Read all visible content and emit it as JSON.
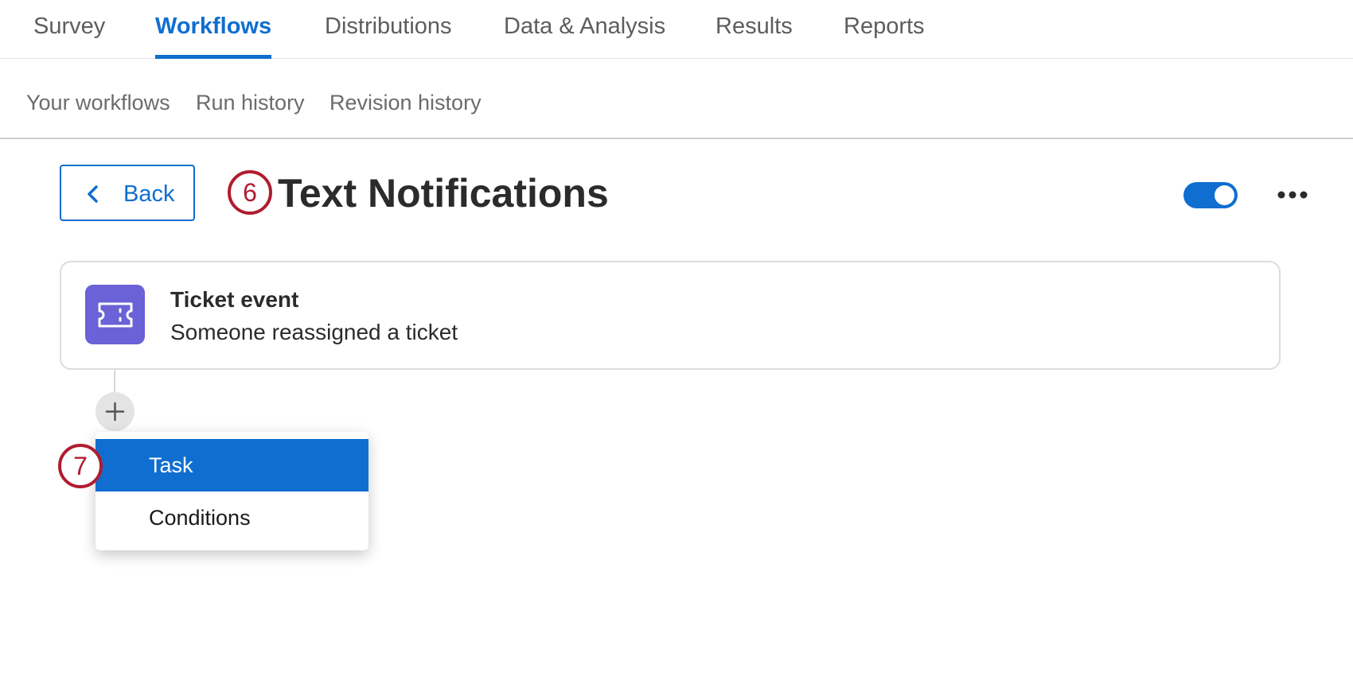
{
  "top_nav": {
    "tabs": [
      {
        "label": "Survey",
        "active": false
      },
      {
        "label": "Workflows",
        "active": true
      },
      {
        "label": "Distributions",
        "active": false
      },
      {
        "label": "Data & Analysis",
        "active": false
      },
      {
        "label": "Results",
        "active": false
      },
      {
        "label": "Reports",
        "active": false
      }
    ]
  },
  "sub_nav": {
    "items": [
      "Your workflows",
      "Run history",
      "Revision history"
    ]
  },
  "header": {
    "back_label": "Back",
    "step_badge": "6",
    "title": "Text Notifications",
    "toggle_on": true
  },
  "trigger_card": {
    "icon": "ticket-icon",
    "title": "Ticket event",
    "description": "Someone reassigned a ticket"
  },
  "add_menu": {
    "step_badge": "7",
    "items": [
      {
        "label": "Task",
        "selected": true
      },
      {
        "label": "Conditions",
        "selected": false
      }
    ]
  },
  "colors": {
    "accent": "#0f6ed0",
    "badge": "#b01c2e",
    "ticket_tile": "#6a62d6"
  }
}
